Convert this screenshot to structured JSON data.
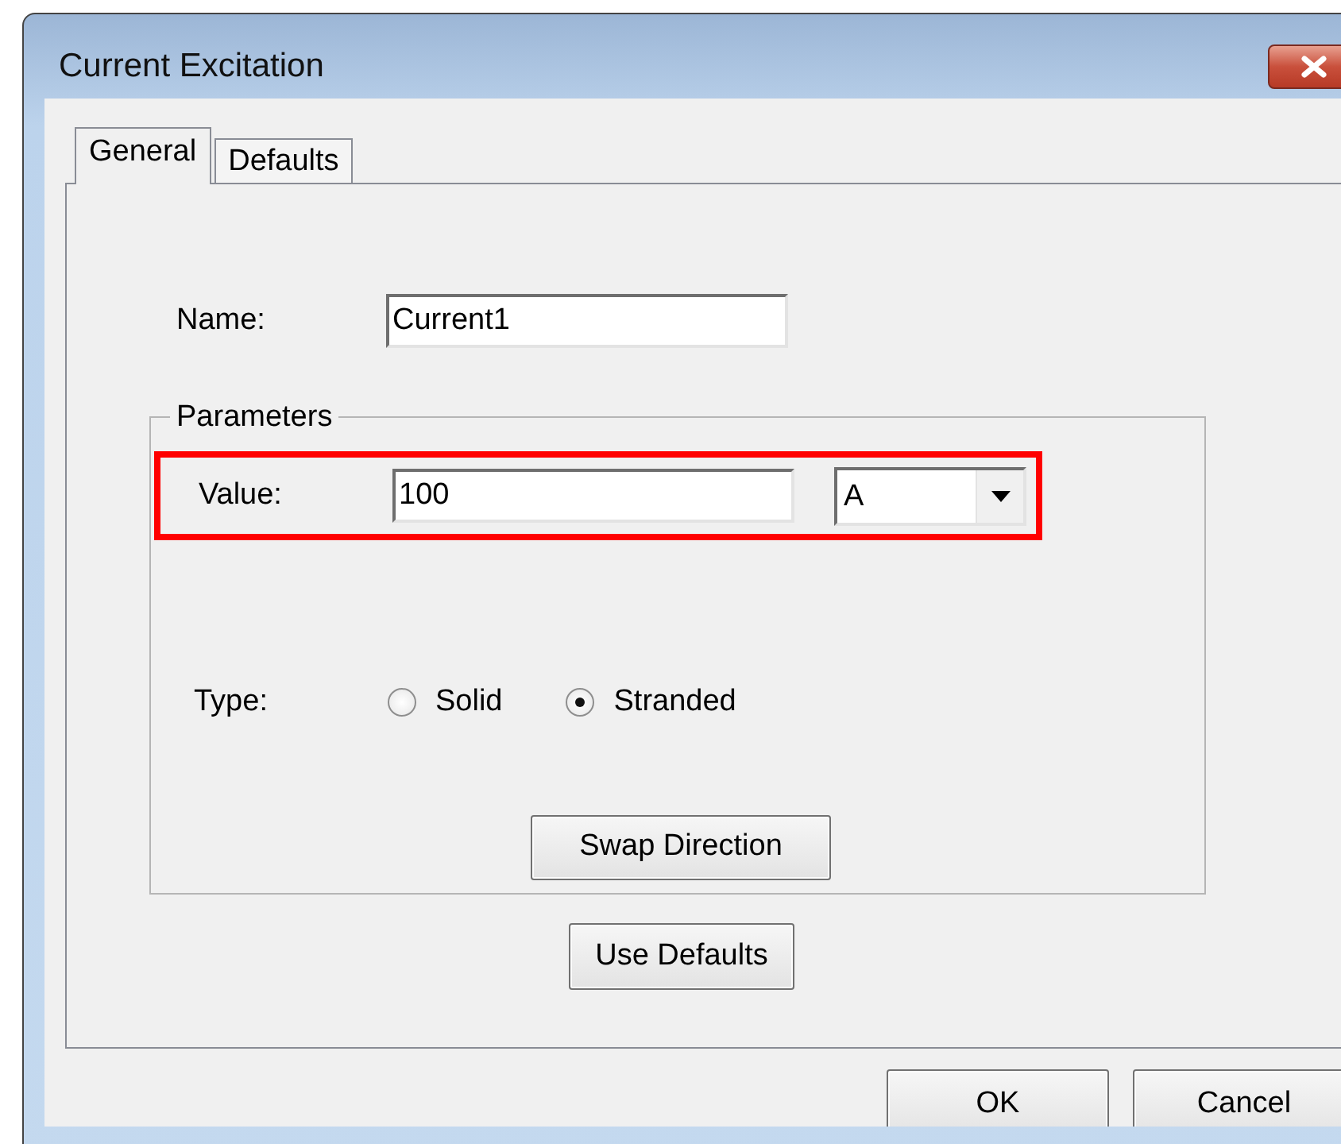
{
  "window": {
    "title": "Current Excitation"
  },
  "tabs": [
    {
      "label": "General",
      "selected": true
    },
    {
      "label": "Defaults",
      "selected": false
    }
  ],
  "name_field": {
    "label": "Name:",
    "value": "Current1"
  },
  "parameters": {
    "title": "Parameters",
    "value_field": {
      "label": "Value:",
      "value": "100",
      "highlighted": true
    },
    "unit_dropdown": {
      "value": "A"
    },
    "type": {
      "label": "Type:",
      "options": [
        {
          "label": "Solid",
          "selected": false
        },
        {
          "label": "Stranded",
          "selected": true
        }
      ]
    },
    "swap_button": "Swap Direction"
  },
  "use_defaults_button": "Use Defaults",
  "buttons": [
    "OK",
    "Cancel"
  ]
}
